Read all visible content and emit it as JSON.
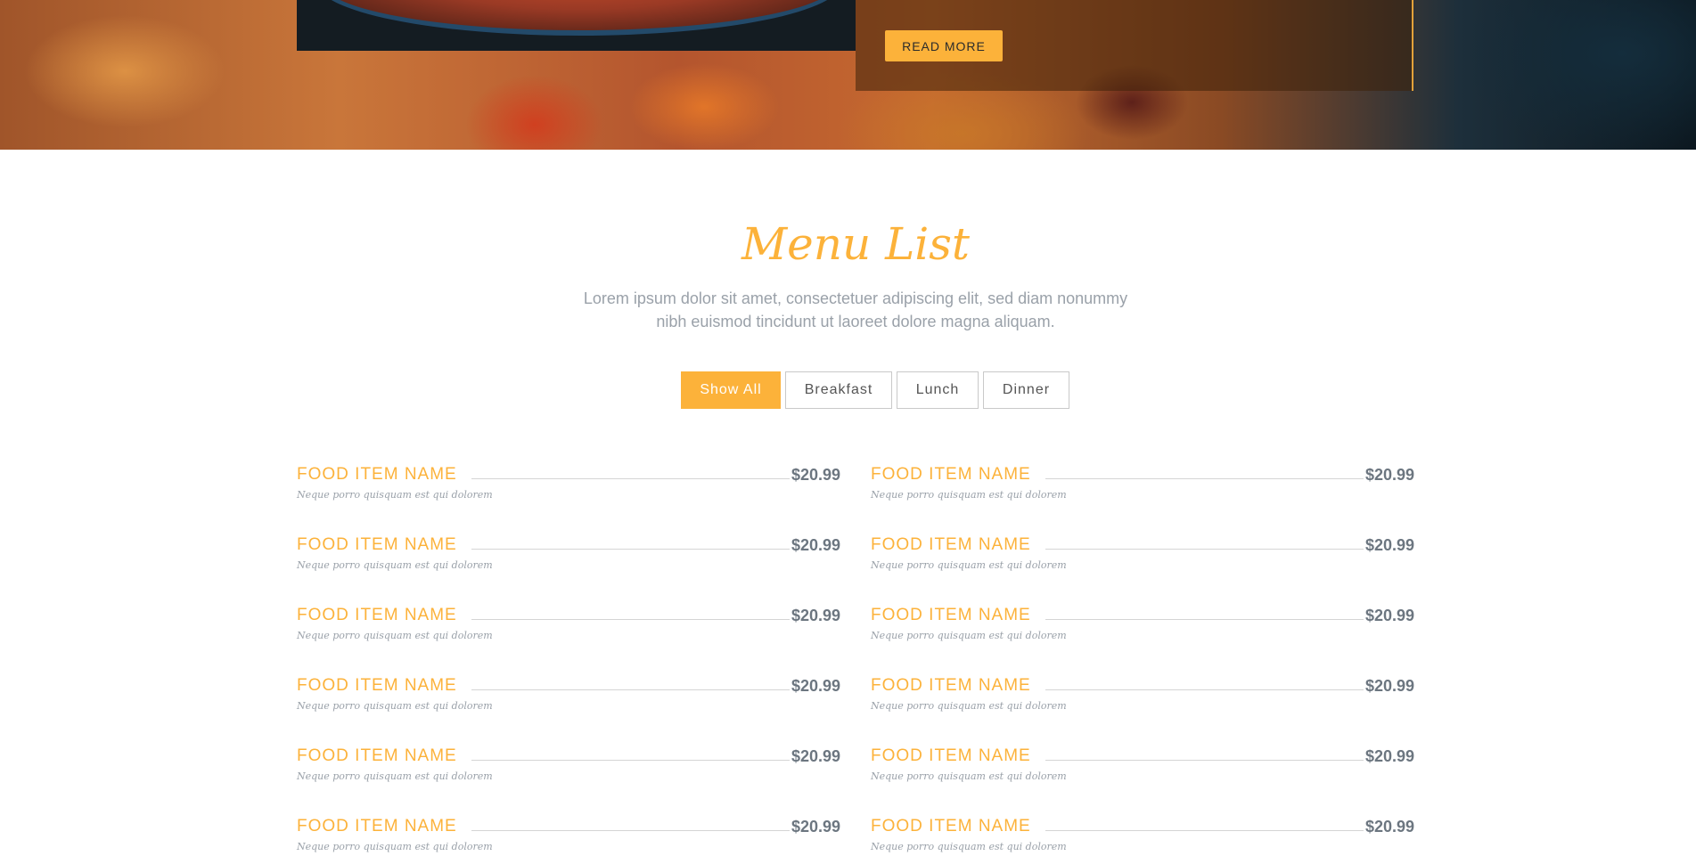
{
  "hero": {
    "read_more_label": "READ MORE"
  },
  "menu": {
    "title": "Menu List",
    "subtitle_line1": "Lorem ipsum dolor sit amet, consectetuer adipiscing elit, sed diam nonummy",
    "subtitle_line2": "nibh euismod tincidunt ut laoreet dolore magna aliquam.",
    "filters": [
      {
        "label": "Show All",
        "active": true
      },
      {
        "label": "Breakfast",
        "active": false
      },
      {
        "label": "Lunch",
        "active": false
      },
      {
        "label": "Dinner",
        "active": false
      }
    ],
    "items": [
      {
        "name": "FOOD ITEM NAME",
        "price": "$20.99",
        "desc": "Neque porro quisquam est qui dolorem"
      },
      {
        "name": "FOOD ITEM NAME",
        "price": "$20.99",
        "desc": "Neque porro quisquam est qui dolorem"
      },
      {
        "name": "FOOD ITEM NAME",
        "price": "$20.99",
        "desc": "Neque porro quisquam est qui dolorem"
      },
      {
        "name": "FOOD ITEM NAME",
        "price": "$20.99",
        "desc": "Neque porro quisquam est qui dolorem"
      },
      {
        "name": "FOOD ITEM NAME",
        "price": "$20.99",
        "desc": "Neque porro quisquam est qui dolorem"
      },
      {
        "name": "FOOD ITEM NAME",
        "price": "$20.99",
        "desc": "Neque porro quisquam est qui dolorem"
      },
      {
        "name": "FOOD ITEM NAME",
        "price": "$20.99",
        "desc": "Neque porro quisquam est qui dolorem"
      },
      {
        "name": "FOOD ITEM NAME",
        "price": "$20.99",
        "desc": "Neque porro quisquam est qui dolorem"
      },
      {
        "name": "FOOD ITEM NAME",
        "price": "$20.99",
        "desc": "Neque porro quisquam est qui dolorem"
      },
      {
        "name": "FOOD ITEM NAME",
        "price": "$20.99",
        "desc": "Neque porro quisquam est qui dolorem"
      },
      {
        "name": "FOOD ITEM NAME",
        "price": "$20.99",
        "desc": "Neque porro quisquam est qui dolorem"
      },
      {
        "name": "FOOD ITEM NAME",
        "price": "$20.99",
        "desc": "Neque porro quisquam est qui dolorem"
      }
    ]
  },
  "colors": {
    "accent": "#fcb23a",
    "price": "#6c7680",
    "muted": "#9aa1a9"
  }
}
